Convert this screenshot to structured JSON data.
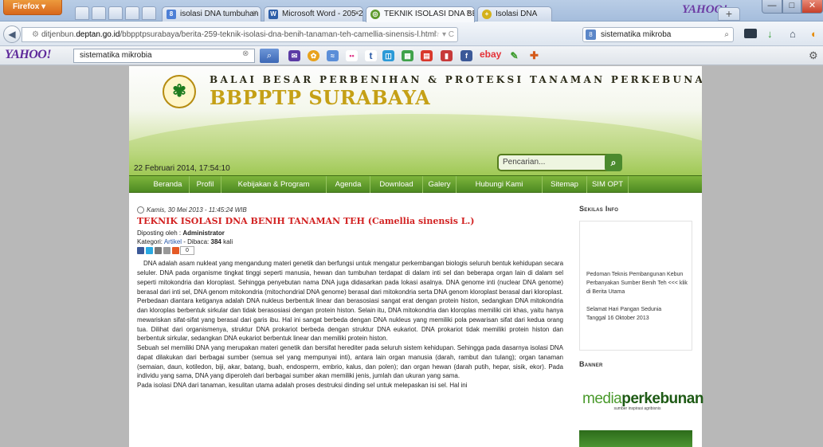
{
  "browser": {
    "menu_button": "Firefox ▾",
    "tabs": [
      {
        "title": "isolasi DNA tumbuhan - Penelusur...",
        "favicon": "google-search-icon",
        "active": false
      },
      {
        "title": "Microsoft Word - 205-214, Annisa ...",
        "favicon": "word-doc-icon",
        "active": false
      },
      {
        "title": "TEKNIK ISOLASI DNA BENIH TANA...",
        "favicon": "site-favicon",
        "active": true
      },
      {
        "title": "Isolasi DNA",
        "favicon": "site-favicon",
        "active": false
      }
    ],
    "yahoo_brand": "YAHOO!",
    "new_tab": "+",
    "url_prefix": "ditjenbun.",
    "url_domain": "deptan.go.id",
    "url_rest": "/bbpptpsurabaya/berita-259-teknik-isolasi-dna-benih-tanaman-teh-camellia-sinensis-l.html",
    "url_controls": "☆ ▾ C",
    "search_value": "sistematika mikroba",
    "win_min": "—",
    "win_max": "□",
    "win_close": "✕"
  },
  "yahoo_toolbar": {
    "logo": "YAHOO!",
    "search_value": "sistematika mikrobia",
    "ebay": "ebay"
  },
  "site": {
    "title": "BALAI BESAR PERBENIHAN & PROTEKSI TANAMAN PERKEBUNAN",
    "name": "BBPPTP SURABAYA",
    "datetime": "22 Februari 2014, 17:54:10",
    "search_placeholder": "Pencarian...",
    "menu": [
      "Beranda",
      "Profil",
      "Kebijakan & Program",
      "Agenda",
      "Download",
      "Galery",
      "Hubungi Kami",
      "Sitemap",
      "SIM OPT"
    ]
  },
  "post": {
    "date": "Kamis, 30 Mei 2013 - 11:45:24 WIB",
    "title": "TEKNIK ISOLASI DNA BENIH TANAMAN TEH (Camellia sinensis L.)",
    "posted_by_label": "Diposting oleh : ",
    "author": "Administrator",
    "category_label": "Kategori: ",
    "category": "Artikel",
    "read_label": " - Dibaca: ",
    "reads": "384",
    "read_unit": " kali",
    "share_count": "0",
    "paragraphs": [
      "DNA adalah asam nukleat yang mengandung materi genetik dan berfungsi untuk mengatur perkembangan biologis seluruh bentuk kehidupan secara seluler. DNA pada organisme tingkat tinggi seperti manusia, hewan dan tumbuhan terdapat di dalam inti sel dan beberapa organ lain di dalam sel seperti mitokondria dan kloroplast. Sehingga penyebutan nama DNA juga didasarkan pada lokasi asalnya. DNA genome inti (nuclear DNA genome) berasal dari inti sel, DNA genom mitokondria (mitochondrial DNA genome) berasal dari mitokondria serta DNA genom kloroplast berasal dari kloroplast.",
      "Perbedaan diantara ketiganya adalah DNA nukleus berbentuk linear dan berasosiasi sangat erat dengan protein histon, sedangkan DNA mitokondria dan kloroplas berbentuk sirkular dan tidak berasosiasi dengan protein histon. Selain itu, DNA mitokondria dan kloroplas memiliki ciri khas, yaitu hanya mewariskan sifat-sifat yang berasal dari garis ibu. Hal ini sangat berbeda dengan DNA nukleus yang memiliki pola pewarisan sifat dari kedua orang tua. Dilihat dari organismenya, struktur DNA prokariot berbeda dengan struktur DNA eukariot. DNA prokariot tidak memiliki protein histon dan berbentuk sirkular, sedangkan DNA eukariot berbentuk linear dan memiliki protein histon.",
      "Sebuah sel memiliki DNA yang merupakan materi genetik dan bersifat herediter pada seluruh sistem kehidupan. Sehingga pada dasarnya isolasi DNA dapat dilakukan dari berbagai sumber (semua sel yang mempunyai inti), antara lain organ manusia (darah, rambut dan tulang); organ tanaman (semaian, daun, kotiledon, biji, akar, batang, buah, endosperm, embrio, kalus, dan polen); dan organ hewan (darah putih, hepar, sisik, ekor). Pada individu yang sama, DNA yang diperoleh dari berbagai sumber akan memiliki jenis, jumlah dan ukuran yang sama.",
      "Pada isolasi DNA dari tanaman, kesulitan utama adalah proses destruksi dinding sel untuk melepaskan isi sel. Hal ini"
    ]
  },
  "sidebar": {
    "info_title": "Sekilas Info",
    "info_items": [
      "Pedoman Teknis Pembangunan Kebun Perbanyakan Sumber Benih Teh <<< klik di Berita Utama",
      "Selamat Hari Pangan Sedunia Tanggal 16 Oktober 2013"
    ],
    "banner_title": "Banner",
    "banner_name_a": "media",
    "banner_name_b": "perkebunan",
    "banner_tagline": "sumber inspirasi agribisnis"
  }
}
